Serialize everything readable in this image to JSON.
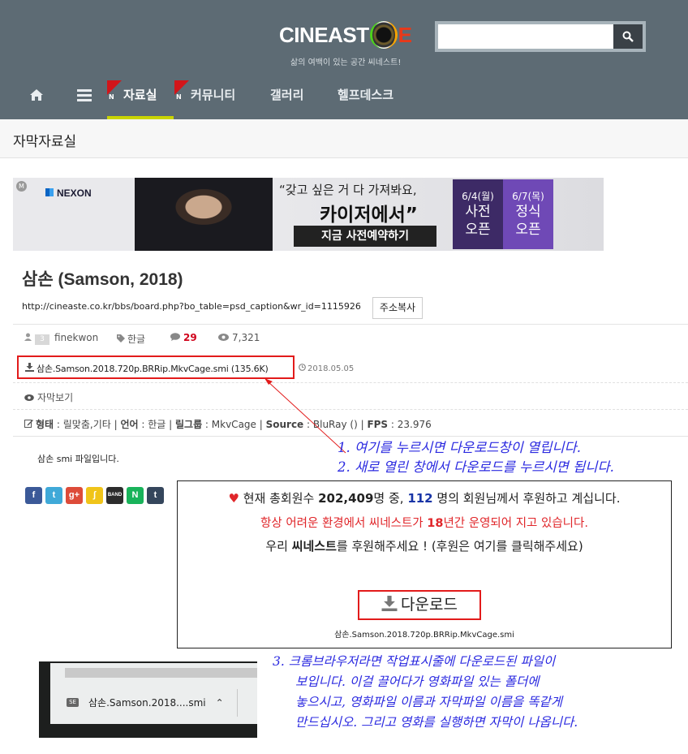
{
  "header": {
    "logo_text": "CINEAST",
    "logo_e": "E",
    "tagline": "삶의 여백이 있는 공간 씨네스트!",
    "search_placeholder": ""
  },
  "nav": {
    "items": [
      {
        "label": "자료실",
        "badge": "N"
      },
      {
        "label": "커뮤니티",
        "badge": "N"
      },
      {
        "label": "갤러리"
      },
      {
        "label": "헬프데스크"
      }
    ]
  },
  "section_title": "자막자료실",
  "banner": {
    "badge": "M",
    "brand": "NEXON",
    "quote": "“갖고 싶은 거 다 가져봐요,",
    "headline": "카이저에서”",
    "cta": "지금 사전예약하기",
    "date1": {
      "day": "6/4(월)",
      "w1": "사전",
      "w2": "오픈"
    },
    "date2": {
      "day": "6/7(목)",
      "w1": "정식",
      "w2": "오픈"
    }
  },
  "post": {
    "title": "삼손 (Samson, 2018)",
    "url": "http://cineaste.co.kr/bbs/board.php?bo_table=psd_caption&wr_id=1115926",
    "copy_label": "주소복사",
    "level": "3",
    "author": "finekwon",
    "language": "한글",
    "comments": "29",
    "views": "7,321",
    "file_name": "삼손.Samson.2018.720p.BRRip.MkvCage.smi (135.6K)",
    "file_date": "2018.05.05",
    "view_sub": "자막보기",
    "specs": {
      "type_label": "형태",
      "type": "릴맞춤,기타",
      "lang_label": "언어",
      "lang": "한글",
      "group_label": "릴그룹",
      "group": "MkvCage",
      "source_label": "Source",
      "source": "BluRay ()",
      "fps_label": "FPS",
      "fps": "23.976"
    },
    "body": "삼손 smi 파일입니다."
  },
  "share_icons": [
    "facebook-icon",
    "twitter-icon",
    "googleplus-icon",
    "kakaostory-icon",
    "band-icon",
    "naver-icon",
    "tumblr-icon"
  ],
  "download_panel": {
    "l1_a": " 현재 총회원수 ",
    "l1_count": "202,409",
    "l1_b": "명 중, ",
    "l1_sponsors": "112",
    "l1_c": " 명의 회원님께서 후원하고 계십니다.",
    "l2_a": "항상 어려운 환경에서 씨네스트가 ",
    "l2_years": "18",
    "l2_b": "년간 운영되어 지고 있습니다.",
    "l3_a": "우리 ",
    "l3_site": "씨네스트",
    "l3_b": "를 후원해주세요 ! (후원은 여기를 클릭해주세요)",
    "button": "다운로드",
    "file": "삼손.Samson.2018.720p.BRRip.MkvCage.smi"
  },
  "annotations": {
    "step1": "1. 여기를 누르시면 다운로드창이 열립니다.",
    "step2": "2. 새로 열린 창에서 다운로드를 누르시면 됩니다.",
    "step3_l1": "3. 크롬브라우저라면 작업표시줄에 다운로드된 파일이",
    "step3_l2": "보입니다. 이걸 끌어다가 영화파일 있는 폴더에",
    "step3_l3": "놓으시고, 영화파일 이름과 자막파일 이름을 똑같게",
    "step3_l4": "만드십시오. 그리고 영화를 실행하면 자막이 나옵니다."
  },
  "chrome_bar": {
    "file_label": "삼손.Samson.2018....smi",
    "icon": "SE"
  },
  "colors": {
    "header_bg": "#5d6b74",
    "highlight_red": "#e21b1b",
    "annotation_blue": "#2b2ae0",
    "nav_active_underline": "#c9d400"
  }
}
